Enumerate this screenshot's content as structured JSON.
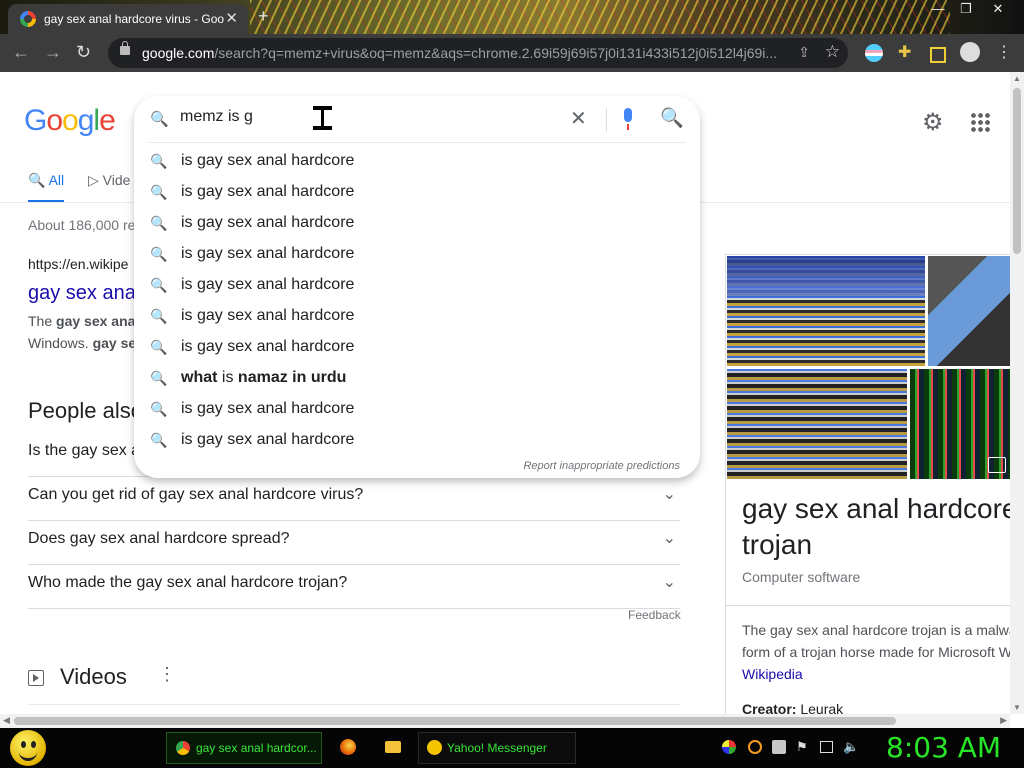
{
  "browser": {
    "tab_title": "gay sex anal hardcore virus - Goo",
    "tab_close": "✕",
    "new_tab": "+",
    "url_host": "google.com",
    "url_rest": "/search?q=memz+virus&oq=memz&aqs=chrome.2.69i59j69i57j0i131i433i512j0i512l4j69i...",
    "window_controls": [
      "—",
      "❐",
      "✕"
    ]
  },
  "google": {
    "logo_letters": [
      "G",
      "o",
      "o",
      "g",
      "l",
      "e"
    ],
    "search_value": "memz is g",
    "suggestions": [
      {
        "pre": "",
        "bold": "",
        "text": "is gay sex anal hardcore"
      },
      {
        "pre": "",
        "bold": "",
        "text": "is gay sex anal hardcore"
      },
      {
        "pre": "",
        "bold": "",
        "text": "is gay sex anal hardcore"
      },
      {
        "pre": "",
        "bold": "",
        "text": "is gay sex anal hardcore"
      },
      {
        "pre": "",
        "bold": "",
        "text": "is gay sex anal hardcore"
      },
      {
        "pre": "",
        "bold": "",
        "text": "is gay sex anal hardcore"
      },
      {
        "pre": "",
        "bold": "",
        "text": "is gay sex anal hardcore"
      },
      {
        "pre": "what",
        "bold": "namaz in urdu",
        "text": "is"
      },
      {
        "pre": "",
        "bold": "",
        "text": "is gay sex anal hardcore"
      },
      {
        "pre": "",
        "bold": "",
        "text": "is gay sex anal hardcore"
      }
    ],
    "report_predictions": "Report inappropriate predictions",
    "tabs": {
      "all": "All",
      "videos": "Vide"
    },
    "result_stats": "About 186,000 re",
    "result": {
      "url": "https://en.wikipe",
      "title": "gay sex ana",
      "snippet_line1_pre": "The ",
      "snippet_line1_bold": "gay sex anal",
      "snippet_line2_pre": "Windows. ",
      "snippet_line2_bold": "gay se"
    },
    "people_also_ask": {
      "title": "People also",
      "questions": [
        "Is the gay sex a",
        "Can you get rid of gay sex anal hardcore virus?",
        "Does gay sex anal hardcore spread?",
        "Who made the gay sex anal hardcore trojan?"
      ]
    },
    "feedback": "Feedback",
    "videos_title": "Videos",
    "knowledge_panel": {
      "title": "gay sex anal hardcore trojan",
      "subtitle": "Computer software",
      "desc_line1": "The gay sex anal hardcore trojan is a malware",
      "desc_line2": "form of a trojan horse made for Microsoft W",
      "source": "Wikipedia",
      "creator_label": "Creator:",
      "creator_value": "Leurak"
    }
  },
  "taskbar": {
    "chrome_task": "gay sex anal hardcor...",
    "yahoo_task": "Yahoo! Messenger",
    "clock": "8:03 AM"
  }
}
